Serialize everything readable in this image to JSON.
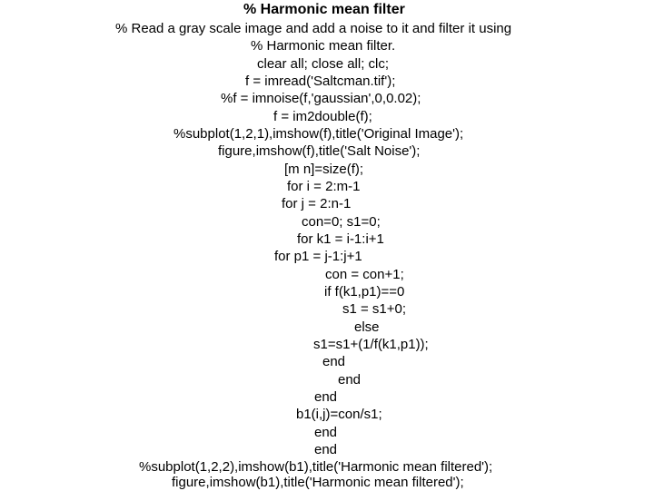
{
  "slide": {
    "title": "% Harmonic mean filter",
    "lines": [
      "% Read a gray scale image and add a noise to it and filter it using",
      "% Harmonic mean filter.",
      "clear all; close all; clc;",
      "f = imread('Saltcman.tif');",
      "%f = imnoise(f,'gaussian',0,0.02);",
      "f = im2double(f);",
      "%subplot(1,2,1),imshow(f),title('Original Image');",
      "figure,imshow(f),title('Salt Noise');",
      "[m n]=size(f);",
      "for i = 2:m-1",
      "for j = 2:n-1",
      "con=0; s1=0;",
      "for k1 = i-1:i+1",
      "for p1 = j-1:j+1",
      "con = con+1;",
      "if f(k1,p1)==0",
      "s1 = s1+0;",
      "else",
      "s1=s1+(1/f(k1,p1));",
      "end",
      "end",
      "end",
      "b1(i,j)=con/s1;",
      "end",
      "end",
      "%subplot(1,2,2),imshow(b1),title('Harmonic mean filtered');",
      "figure,imshow(b1),title('Harmonic mean filtered');"
    ]
  }
}
